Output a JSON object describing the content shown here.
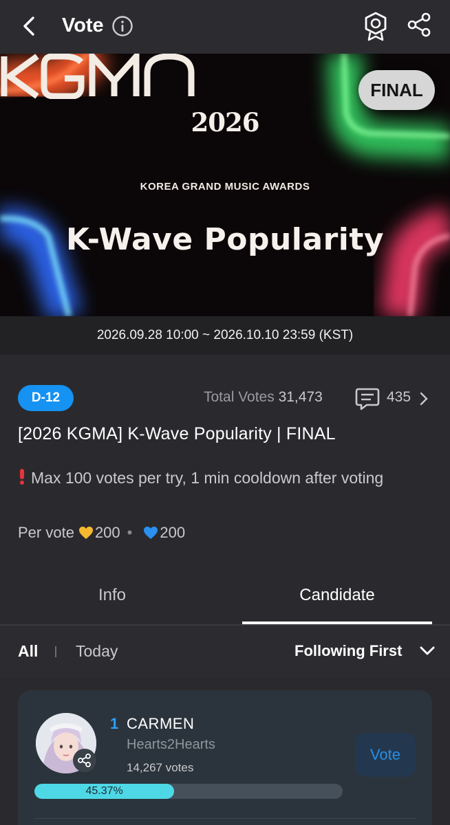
{
  "header": {
    "title": "Vote"
  },
  "banner": {
    "status_badge": "FINAL",
    "year": "2026",
    "logo_text": "KGMA",
    "subtitle": "KOREA GRAND MUSIC AWARDS",
    "category": "K-Wave Popularity"
  },
  "period": "2026.09.28 10:00 ~ 2026.10.10 23:59 (KST)",
  "summary": {
    "dday": "D-12",
    "total_label": "Total Votes",
    "total_votes": "31,473",
    "comments": "435"
  },
  "vote_title": "[2026 KGMA] K-Wave Popularity | FINAL",
  "notice": "Max 100 votes per try, 1 min cooldown after voting",
  "per_vote": {
    "label": "Per vote",
    "gold_cost": "200",
    "blue_cost": "200",
    "gold_color": "#f5b82e",
    "blue_color": "#2b8ff0"
  },
  "tabs": [
    {
      "label": "Info",
      "active": false
    },
    {
      "label": "Candidate",
      "active": true
    }
  ],
  "filter": {
    "all": "All",
    "today": "Today",
    "sort": "Following First"
  },
  "candidates": [
    {
      "rank": "1",
      "name": "CARMEN",
      "group": "Hearts2Hearts",
      "votes": "14,267 votes",
      "percent_label": "45.37%",
      "percent": 45.37,
      "vote_label": "Vote"
    }
  ],
  "colors": {
    "accent": "#1592f2",
    "progress": "#4ed8e6",
    "background": "#2a2a2e"
  }
}
